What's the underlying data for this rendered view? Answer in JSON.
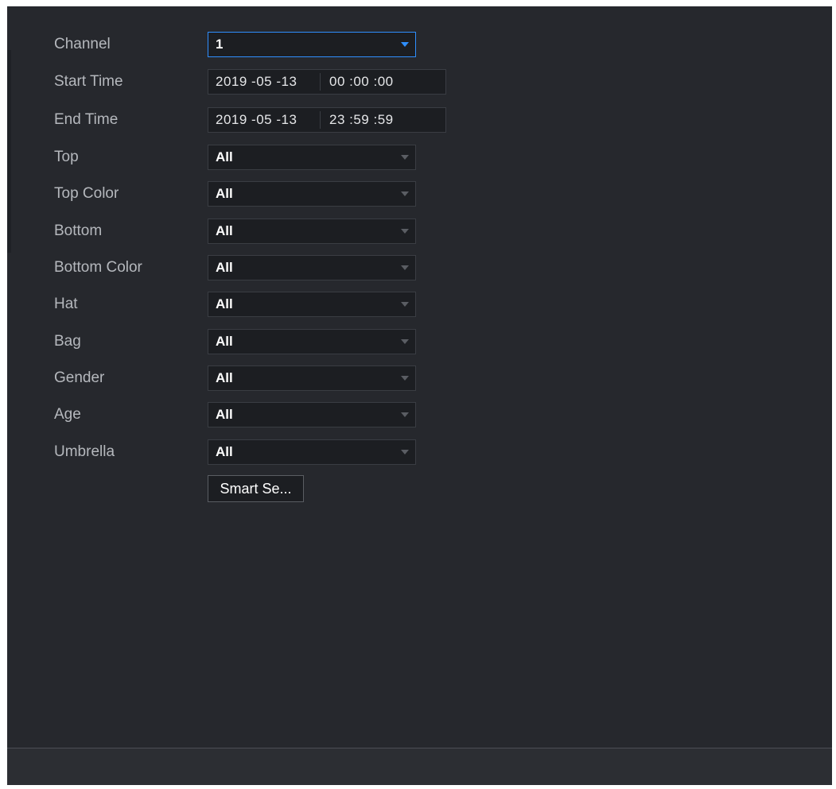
{
  "form": {
    "channel": {
      "label": "Channel",
      "value": "1"
    },
    "start_time": {
      "label": "Start Time",
      "date": "2019 -05 -13",
      "time": "00 :00 :00"
    },
    "end_time": {
      "label": "End Time",
      "date": "2019 -05 -13",
      "time": "23 :59 :59"
    },
    "filters": [
      {
        "label": "Top",
        "value": "All"
      },
      {
        "label": "Top Color",
        "value": "All"
      },
      {
        "label": "Bottom",
        "value": "All"
      },
      {
        "label": "Bottom Color",
        "value": "All"
      },
      {
        "label": "Hat",
        "value": "All"
      },
      {
        "label": "Bag",
        "value": "All"
      },
      {
        "label": "Gender",
        "value": "All"
      },
      {
        "label": "Age",
        "value": "All"
      },
      {
        "label": "Umbrella",
        "value": "All"
      }
    ],
    "smart_search_label": "Smart Se..."
  },
  "colors": {
    "background": "#26282d",
    "field": "#1c1e22",
    "accent": "#2f8fff",
    "label": "#b5b8bd"
  }
}
